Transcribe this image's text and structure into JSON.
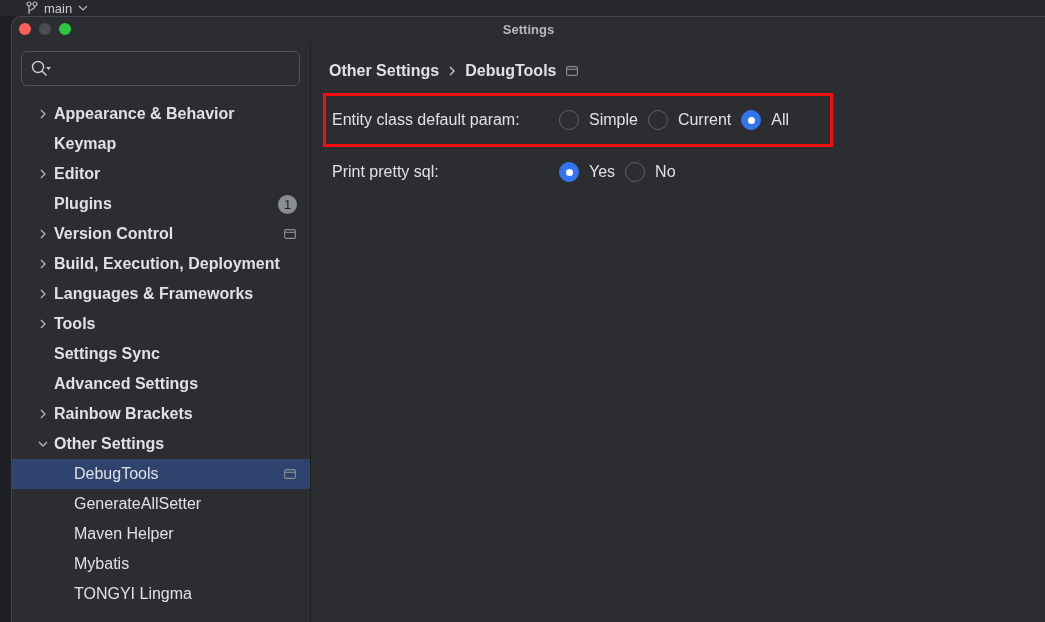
{
  "background": {
    "branch": "main"
  },
  "window": {
    "title": "Settings"
  },
  "sidebar": {
    "items": [
      {
        "label": "Appearance & Behavior",
        "expanded": false,
        "selected": false
      },
      {
        "label": "Keymap",
        "selected": false
      },
      {
        "label": "Editor",
        "expanded": false,
        "selected": false
      },
      {
        "label": "Plugins",
        "selected": false,
        "badge": "1"
      },
      {
        "label": "Version Control",
        "expanded": false,
        "selected": false,
        "project_level": true
      },
      {
        "label": "Build, Execution, Deployment",
        "expanded": false,
        "selected": false
      },
      {
        "label": "Languages & Frameworks",
        "expanded": false,
        "selected": false
      },
      {
        "label": "Tools",
        "expanded": false,
        "selected": false
      },
      {
        "label": "Settings Sync",
        "selected": false
      },
      {
        "label": "Advanced Settings",
        "selected": false
      },
      {
        "label": "Rainbow Brackets",
        "expanded": false,
        "selected": false
      },
      {
        "label": "Other Settings",
        "expanded": true,
        "selected": false,
        "children": [
          {
            "label": "DebugTools",
            "selected": true,
            "project_level": true
          },
          {
            "label": "GenerateAllSetter",
            "selected": false
          },
          {
            "label": "Maven Helper",
            "selected": false
          },
          {
            "label": "Mybatis",
            "selected": false
          },
          {
            "label": "TONGYI Lingma",
            "selected": false
          }
        ]
      }
    ]
  },
  "content": {
    "breadcrumb": [
      {
        "label": "Other Settings"
      },
      {
        "label": "DebugTools"
      }
    ],
    "project_level": true,
    "settings": [
      {
        "label": "Entity class default param:",
        "highlighted": true,
        "options": [
          {
            "label": "Simple",
            "selected": false
          },
          {
            "label": "Current",
            "selected": false
          },
          {
            "label": "All",
            "selected": true
          }
        ]
      },
      {
        "label": "Print pretty sql:",
        "highlighted": false,
        "options": [
          {
            "label": "Yes",
            "selected": true
          },
          {
            "label": "No",
            "selected": false
          }
        ]
      }
    ]
  }
}
